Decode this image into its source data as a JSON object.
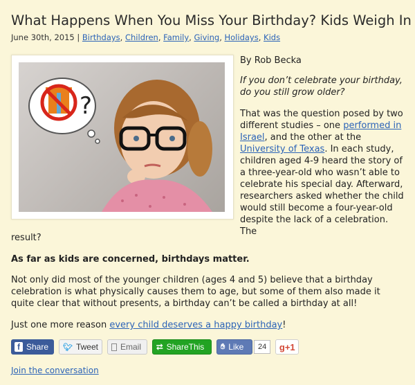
{
  "article": {
    "title": "What Happens When You Miss Your Birthday? Kids Weigh In",
    "date": "June 30th, 2015",
    "separator": "|",
    "tags": [
      "Birthdays",
      "Children",
      "Family",
      "Giving",
      "Holidays",
      "Kids"
    ],
    "byline": "By Rob Becka",
    "lead_question": "If you don’t celebrate your birthday, do you still grow older?",
    "p1_start": "That was the question posed by two different studies – one ",
    "p1_link1": "performed in Israel",
    "p1_mid": ", and the other at the ",
    "p1_link2": "University of Texas",
    "p1_end": ". In each study, children aged 4-9 heard the story of a three-year-old who wasn’t able to celebrate his special day. Afterward, researchers asked whether the child would still become a four-year-old despite the lack of a celebration. The",
    "p1_tail": "result?",
    "p2_bold": "As far as kids are concerned, birthdays matter.",
    "p3": "Not only did most of the younger children (ages 4 and 5) believe that a birthday celebration is what physically causes them to age, but some of them also made it quite clear that without  presents, a birthday can’t be called a birthday at all!",
    "p4_start": "Just one more reason ",
    "p4_link": "every child deserves a happy birthday",
    "p4_end": "!"
  },
  "share": {
    "facebook_label": "Share",
    "twitter_label": "Tweet",
    "email_label": "Email",
    "sharethis_label": "ShareThis",
    "like_label": "Like",
    "like_count": "24",
    "gplus_label": "+1",
    "facebook_icon": "f",
    "gplus_icon": "g"
  },
  "footer": {
    "join_label": "Join the conversation"
  },
  "colors": {
    "background": "#fbf6d9",
    "link": "#2b63b7",
    "facebook": "#3b5b9a",
    "sharethis": "#22a323",
    "like": "#5e7ab5",
    "gplus": "#d34836"
  }
}
